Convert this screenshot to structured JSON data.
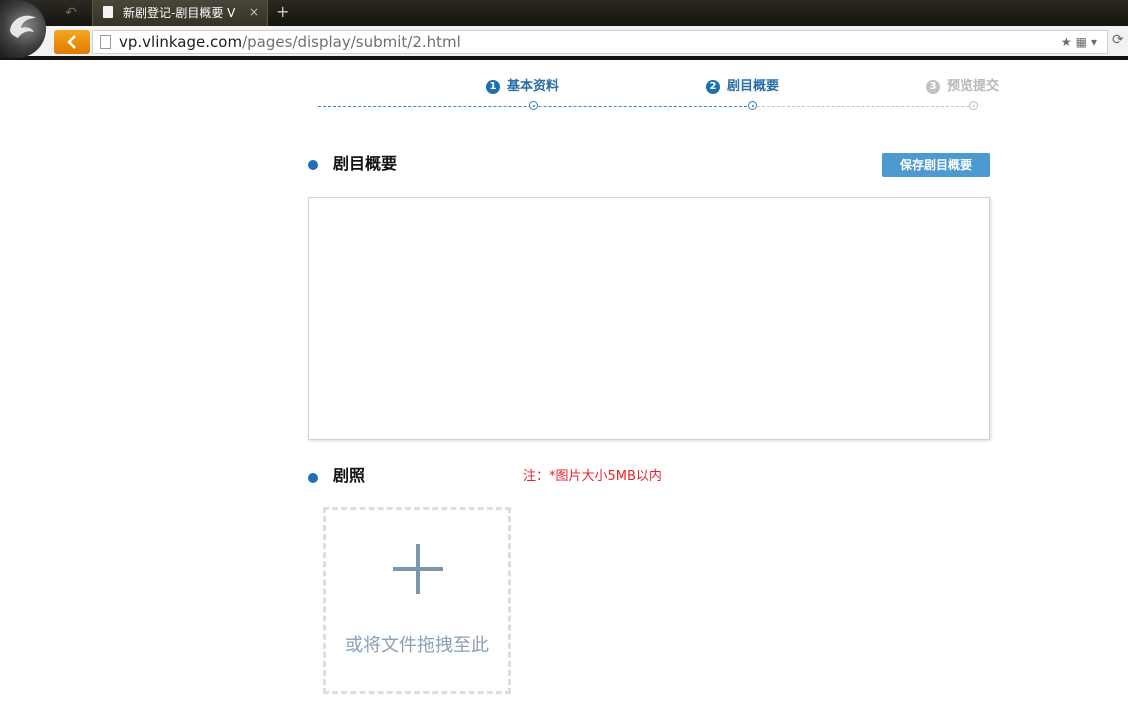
{
  "browser": {
    "tab_title": "新剧登记-剧目概要 V",
    "tab_close": "×",
    "new_tab": "+",
    "url_domain": "vp.vlinkage.com",
    "url_path": "/pages/display/submit/2.html",
    "icons": [
      "browser-logo-icon",
      "back-arrow-icon",
      "page-icon",
      "star-icon",
      "qr-code-icon",
      "dropdown-icon",
      "reload-icon"
    ],
    "accent": "#e88a0c"
  },
  "steps": [
    {
      "num": "1",
      "label": "基本资料",
      "state": "done"
    },
    {
      "num": "2",
      "label": "剧目概要",
      "state": "current"
    },
    {
      "num": "3",
      "label": "预览提交",
      "state": "pending"
    }
  ],
  "summary": {
    "title": "剧目概要",
    "save_label": "保存剧目概要",
    "content": ""
  },
  "photos": {
    "title": "剧照",
    "note": "注：*图片大小5MB以内",
    "drop_text": "或将文件拖拽至此"
  },
  "colors": {
    "primary": "#1f6fb8",
    "button": "#4c9ad0",
    "note": "#e4262c",
    "inactive": "#b8b8b8"
  }
}
